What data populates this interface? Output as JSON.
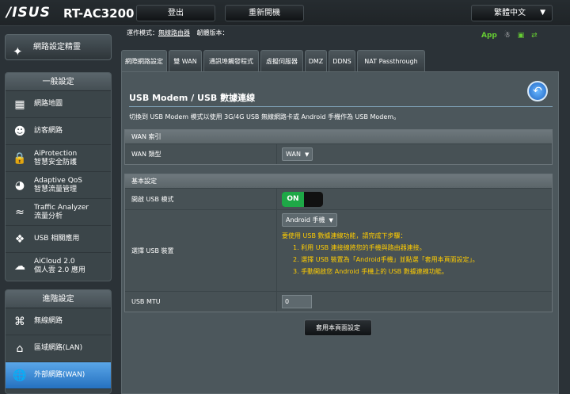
{
  "header": {
    "logo": "/ISUS",
    "model": "RT-AC3200",
    "logout": "登出",
    "reboot": "重新開機",
    "language": "繁體中文"
  },
  "status": {
    "mode_label": "運作模式：",
    "mode_value": "無線路由器",
    "firmware_label": "韌體版本："
  },
  "status_icons": {
    "app": "App"
  },
  "sidebar": {
    "qis_label": "網路設定精靈",
    "general_title": "一般設定",
    "general_items": [
      {
        "icon": "network-map-icon",
        "label": "網路地圖"
      },
      {
        "icon": "guest-network-icon",
        "label": "訪客網路"
      },
      {
        "icon": "aiprotection-icon",
        "label": "AiProtection",
        "label2": "智慧安全防護"
      },
      {
        "icon": "qos-icon",
        "label": "Adaptive QoS",
        "label2": "智慧流量管理"
      },
      {
        "icon": "traffic-analyzer-icon",
        "label": "Traffic Analyzer",
        "label2": "流量分析"
      },
      {
        "icon": "usb-icon",
        "label": "USB 相關應用"
      },
      {
        "icon": "aicloud-icon",
        "label": "AiCloud 2.0",
        "label2": "個人雲 2.0 應用"
      }
    ],
    "advanced_title": "進階設定",
    "advanced_items": [
      {
        "icon": "wireless-icon",
        "label": "無線網路"
      },
      {
        "icon": "lan-icon",
        "label": "區域網路(LAN)"
      },
      {
        "icon": "wan-icon",
        "label": "外部網路(WAN)"
      }
    ]
  },
  "tabs": [
    "網際網路設定",
    "雙 WAN",
    "通訊埠觸發程式",
    "虛擬伺服器",
    "DMZ",
    "DDNS",
    "NAT Passthrough"
  ],
  "main": {
    "title": "USB Modem / USB 數據連線",
    "description": "切換到 USB Modem 模式以使用 3G/4G USB 無線網路卡或 Android 手機作為 USB Modem。",
    "wan_index": {
      "header": "WAN 索引",
      "wan_type_label": "WAN 類型",
      "wan_type_value": "WAN"
    },
    "basic": {
      "header": "基本設定",
      "enable_usb_label": "開啟 USB 模式",
      "enable_usb_value": "ON",
      "select_device_label": "選擇 USB 裝置",
      "select_device_value": "Android 手機",
      "instructions_intro": "要使用 USB 數據連線功能，請完成下步驟：",
      "steps": [
        "1.  利用 USB 連接線將您的手機與路由器連接。",
        "2.  選擇 USB 裝置為「Android手機」並點選「套用本頁面設定」。",
        "3.  手動開啟您 Android 手機上的 USB 數據連線功能。"
      ],
      "mtu_label": "USB MTU",
      "mtu_value": "0"
    },
    "apply_label": "套用本頁面設定"
  }
}
